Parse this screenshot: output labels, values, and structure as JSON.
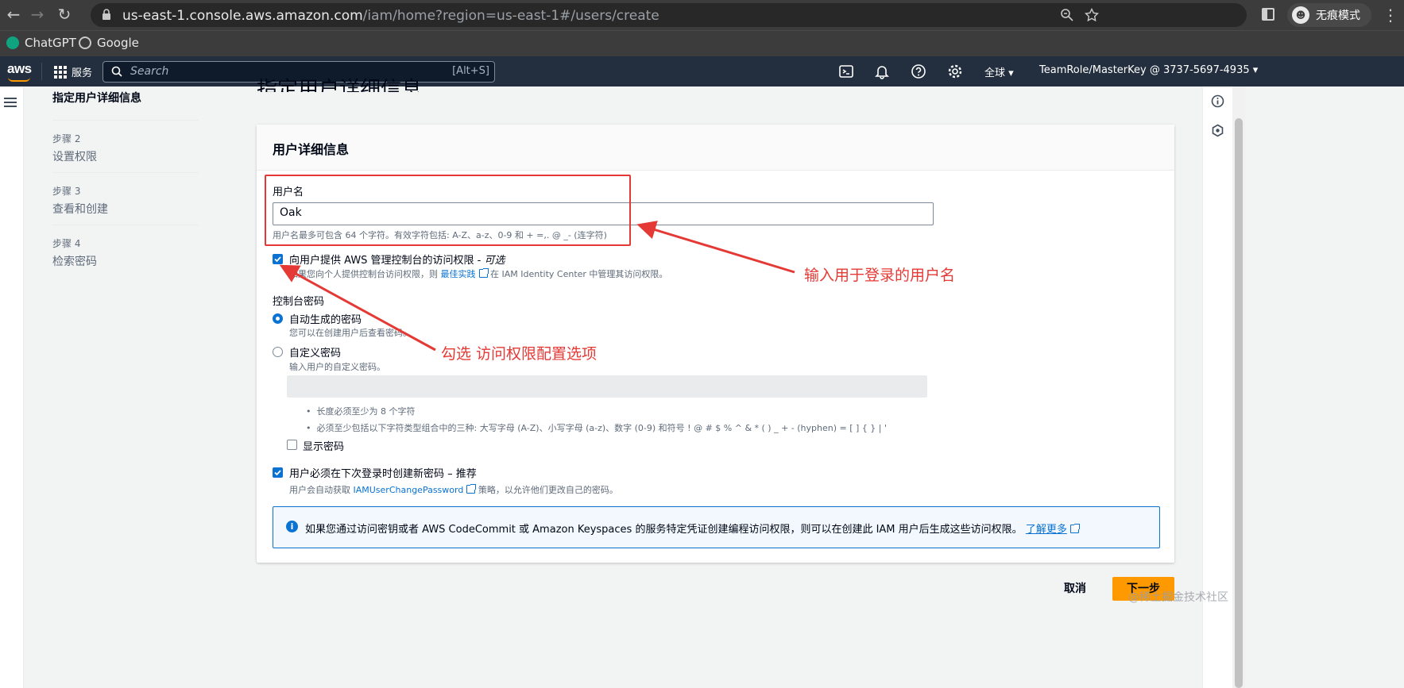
{
  "browser": {
    "url_host": "us-east-1.console.aws.amazon.com",
    "url_path": "/iam/home?region=us-east-1#/users/create",
    "incognito_label": "无痕模式",
    "bookmarks": [
      "ChatGPT",
      "Google"
    ]
  },
  "aws_bar": {
    "logo": "aws",
    "services_label": "服务",
    "search_placeholder": "Search",
    "search_shortcut": "[Alt+S]",
    "region_label": "全球",
    "account_label": "TeamRole/MasterKey @ 3737-5697-4935"
  },
  "steps": [
    {
      "label": "指定用户详细信息"
    },
    {
      "num": "步骤 2",
      "label": "设置权限"
    },
    {
      "num": "步骤 3",
      "label": "查看和创建"
    },
    {
      "num": "步骤 4",
      "label": "检索密码"
    }
  ],
  "page_title": "指定用户详细信息",
  "panel": {
    "heading": "用户详细信息",
    "username_label": "用户名",
    "username_value": "Oak",
    "username_hint": "用户名最多可包含 64 个字符。有效字符包括: A-Z、a-z、0-9 和 + =,. @ _- (连字符)",
    "console_access_label": "向用户提供 AWS 管理控制台的访问权限 - ",
    "console_access_optional": "可选",
    "console_access_desc_pre": "如果您向个人提供控制台访问权限，则",
    "console_access_desc_link": "最佳实践",
    "console_access_desc_post": "在 IAM Identity Center 中管理其访问权限。",
    "console_pw_label": "控制台密码",
    "auto_pw_label": "自动生成的密码",
    "auto_pw_desc": "您可以在创建用户后查看密码。",
    "custom_pw_label": "自定义密码",
    "custom_pw_desc": "输入用户的自定义密码。",
    "rule_1": "长度必须至少为 8 个字符",
    "rule_2": "必须至少包括以下字符类型组合中的三种: 大写字母 (A-Z)、小写字母 (a-z)、数字 (0-9) 和符号 ! @ # $ % ^ & * ( ) _ + - (hyphen) = [ ] { } | '",
    "show_pw_label": "显示密码",
    "reset_label": "用户必须在下次登录时创建新密码 – 推荐",
    "reset_desc_pre": "用户会自动获取",
    "reset_desc_link": "IAMUserChangePassword",
    "reset_desc_post": "策略，以允许他们更改自己的密码。",
    "info_msg": "如果您通过访问密钥或者 AWS CodeCommit 或 Amazon Keyspaces 的服务特定凭证创建编程访问权限，则可以在创建此 IAM 用户后生成这些访问权限。",
    "info_link": "了解更多"
  },
  "actions": {
    "cancel": "取消",
    "next": "下一步"
  },
  "annotations": {
    "username_note": "输入用于登录的用户名",
    "checkbox_note": "勾选 访问权限配置选项"
  },
  "watermark": "@稀土掘金技术社区",
  "colors": {
    "accent": "#0972d3",
    "primary_button": "#ff9900",
    "annotation": "#e53935",
    "aws_nav": "#232f3e"
  }
}
